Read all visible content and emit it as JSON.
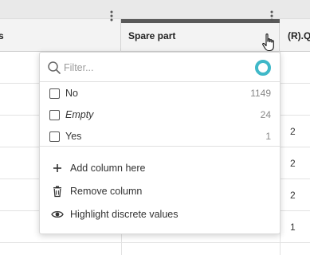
{
  "header": {
    "left_column_fragment": "s",
    "spare_part_label": "Spare part",
    "right_column_fragment": "(R).Q"
  },
  "grid": {
    "right_values": [
      "",
      "",
      "2",
      "2",
      "2",
      "1"
    ]
  },
  "filter_menu": {
    "search_placeholder": "Filter...",
    "search_value": "",
    "options": [
      {
        "label": "No",
        "count": "1149",
        "italic": false
      },
      {
        "label": "Empty",
        "count": "24",
        "italic": true
      },
      {
        "label": "Yes",
        "count": "1",
        "italic": false
      }
    ],
    "actions": [
      {
        "label": "Add column here",
        "icon": "plus-icon"
      },
      {
        "label": "Remove column",
        "icon": "trash-icon"
      },
      {
        "label": "Highlight discrete values",
        "icon": "eye-icon"
      }
    ]
  },
  "icons": {
    "kebab": "kebab-icon",
    "search": "search-icon",
    "loading": "loading-spinner-icon",
    "cursor": "hand-pointer-icon"
  },
  "colors": {
    "accent_teal": "#3fb8c8",
    "active_column_bar": "#595959",
    "header_bg": "#f3f3f3"
  }
}
